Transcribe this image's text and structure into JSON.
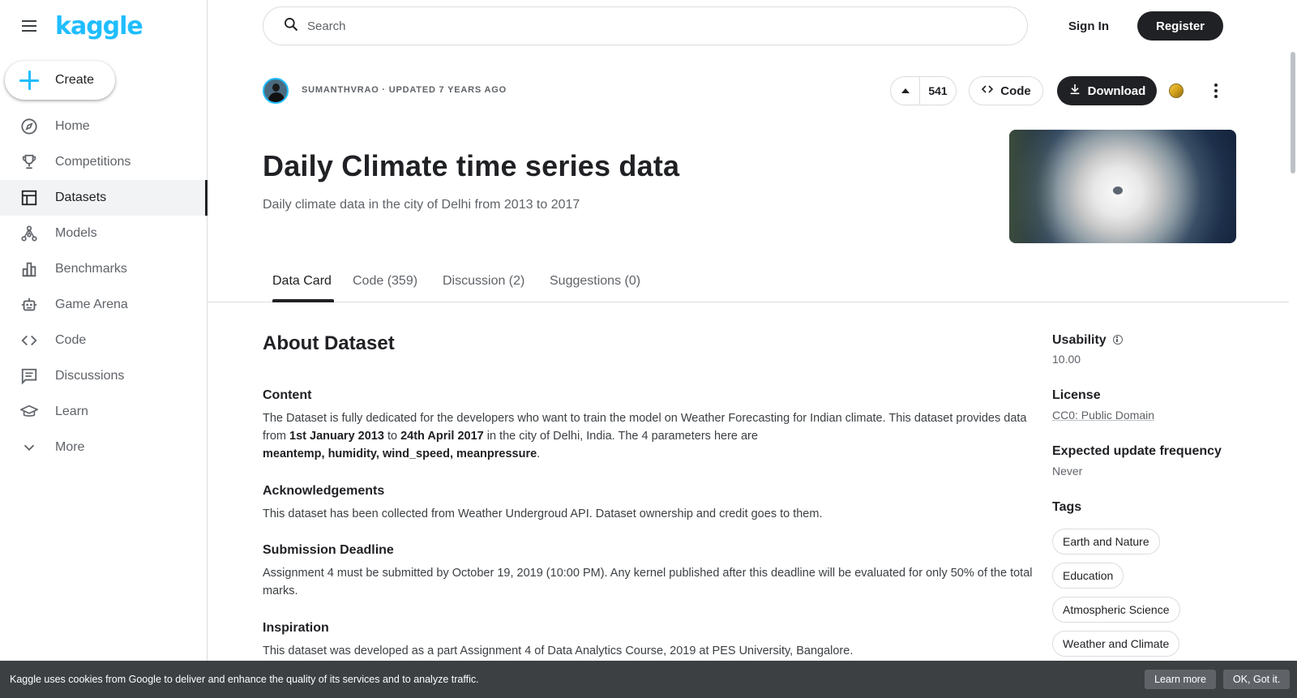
{
  "sidebar": {
    "logo": "kaggle",
    "create_label": "Create",
    "items": [
      {
        "label": "Home",
        "icon": "compass-icon"
      },
      {
        "label": "Competitions",
        "icon": "trophy-icon"
      },
      {
        "label": "Datasets",
        "icon": "table-icon",
        "active": true
      },
      {
        "label": "Models",
        "icon": "models-icon"
      },
      {
        "label": "Benchmarks",
        "icon": "bar-chart-icon"
      },
      {
        "label": "Game Arena",
        "icon": "robot-icon"
      },
      {
        "label": "Code",
        "icon": "code-icon"
      },
      {
        "label": "Discussions",
        "icon": "comment-icon"
      },
      {
        "label": "Learn",
        "icon": "school-icon"
      },
      {
        "label": "More",
        "icon": "chevron-down-icon"
      }
    ]
  },
  "header": {
    "search_placeholder": "Search",
    "signin_label": "Sign In",
    "register_label": "Register"
  },
  "dataset": {
    "meta": "SUMANTHVRAO · UPDATED 7 YEARS AGO",
    "upvotes": "541",
    "code_label": "Code",
    "download_label": "Download",
    "title": "Daily Climate time series data",
    "subtitle": "Daily climate data in the city of Delhi from 2013 to 2017"
  },
  "tabs": [
    "Data Card",
    "Code (359)",
    "Discussion (2)",
    "Suggestions (0)"
  ],
  "about": {
    "heading": "About Dataset",
    "sections": [
      {
        "heading": "Content"
      },
      {
        "heading": "Acknowledgements",
        "text": "This dataset has been collected from Weather Undergroud API. Dataset ownership and credit goes to them."
      },
      {
        "heading": "Submission Deadline",
        "text": "Assignment 4 must be submitted by October 19, 2019 (10:00 PM). Any kernel published after this deadline will be evaluated for only 50% of the total marks."
      },
      {
        "heading": "Inspiration",
        "text": "This dataset was developed as a part Assignment 4 of Data Analytics Course, 2019 at PES University, Bangalore."
      }
    ],
    "content_p1": "The Dataset is fully dedicated for the developers who want to train the model on Weather Forecasting for Indian climate. This dataset provides data from ",
    "content_b1": "1st January 2013",
    "content_p2": " to ",
    "content_b2": "24th April 2017",
    "content_p3": " in the city of Delhi, India. The 4 parameters here are",
    "content_b3": "meantemp, humidity, wind_speed, meanpressure",
    "content_p4": "."
  },
  "right_panel": {
    "usability_label": "Usability",
    "usability_value": "10.00",
    "license_label": "License",
    "license_value": "CC0: Public Domain",
    "update_label": "Expected update frequency",
    "update_value": "Never",
    "tags_label": "Tags",
    "tags": [
      "Earth and Nature",
      "Education",
      "Atmospheric Science",
      "Weather and Climate"
    ]
  },
  "cookie": {
    "text": "Kaggle uses cookies from Google to deliver and enhance the quality of its services and to analyze traffic.",
    "learn_more": "Learn more",
    "ok": "OK, Got it."
  },
  "colors": {
    "brand": "#20beff",
    "dark": "#202124",
    "muted": "#5f6368"
  }
}
